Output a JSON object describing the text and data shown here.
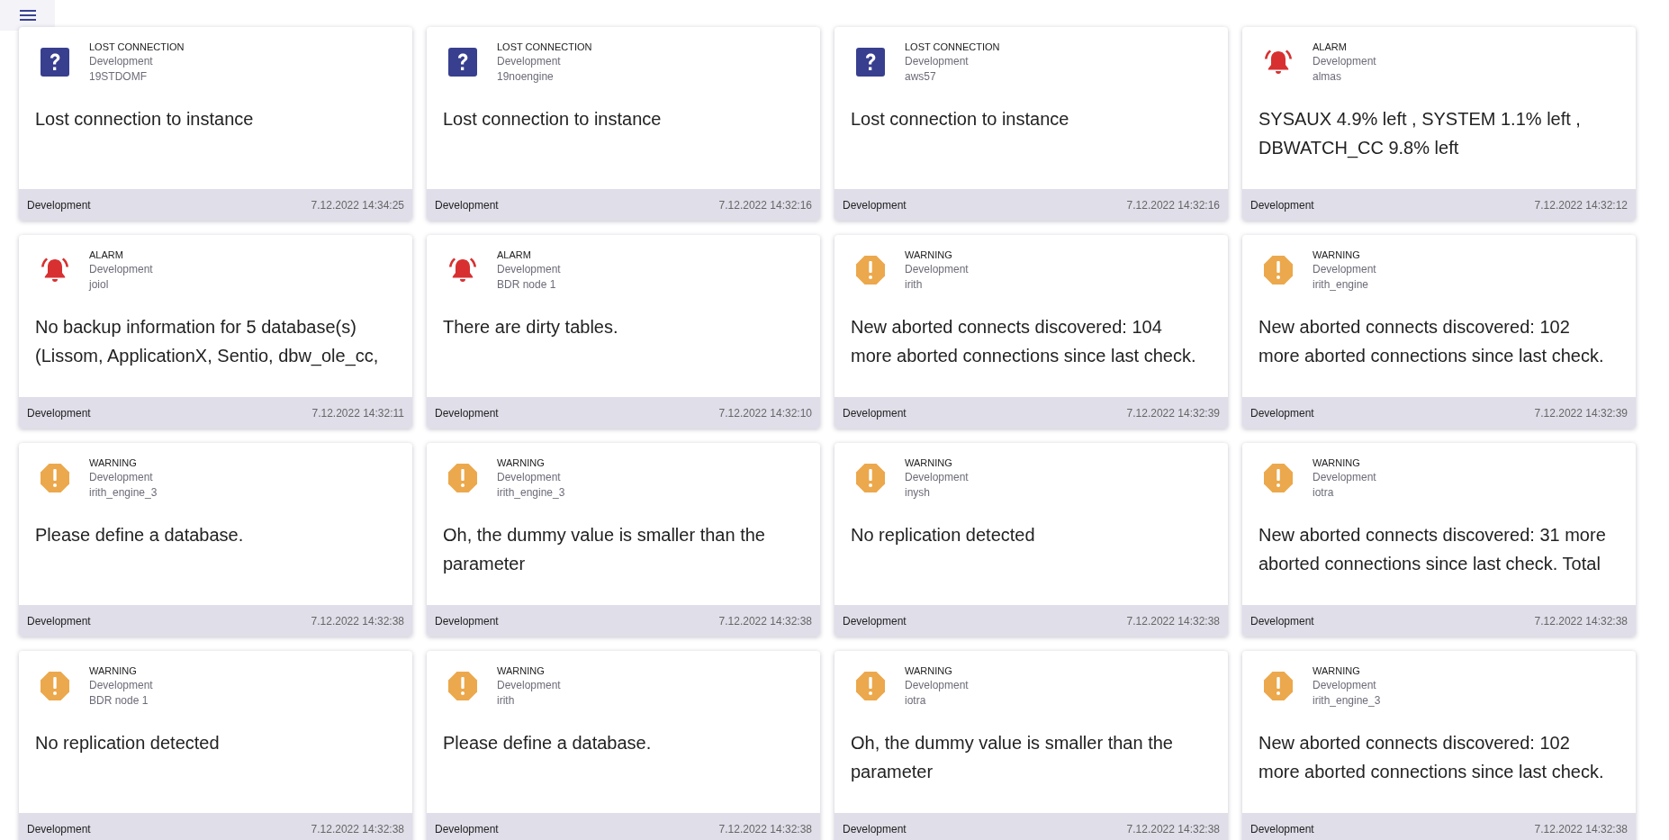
{
  "alerts": [
    {
      "kind": "lost_connection",
      "type_label": "LOST CONNECTION",
      "group": "Development",
      "instance": "19STDOMF",
      "message": "Lost connection to instance",
      "footer_group": "Development",
      "time": "7.12.2022 14:34:25"
    },
    {
      "kind": "lost_connection",
      "type_label": "LOST CONNECTION",
      "group": "Development",
      "instance": "19noengine",
      "message": "Lost connection to instance",
      "footer_group": "Development",
      "time": "7.12.2022 14:32:16"
    },
    {
      "kind": "lost_connection",
      "type_label": "LOST CONNECTION",
      "group": "Development",
      "instance": "aws57",
      "message": "Lost connection to instance",
      "footer_group": "Development",
      "time": "7.12.2022 14:32:16"
    },
    {
      "kind": "alarm",
      "type_label": "ALARM",
      "group": "Development",
      "instance": "almas",
      "message": "SYSAUX 4.9% left , SYSTEM 1.1% left , DBWATCH_CC 9.8% left",
      "footer_group": "Development",
      "time": "7.12.2022 14:32:12"
    },
    {
      "kind": "alarm",
      "type_label": "ALARM",
      "group": "Development",
      "instance": "joiol",
      "message": "No backup information for 5 database(s) (Lissom, ApplicationX, Sentio, dbw_ole_cc,",
      "footer_group": "Development",
      "time": "7.12.2022 14:32:11"
    },
    {
      "kind": "alarm",
      "type_label": "ALARM",
      "group": "Development",
      "instance": "BDR node 1",
      "message": "There are dirty tables.",
      "footer_group": "Development",
      "time": "7.12.2022 14:32:10"
    },
    {
      "kind": "warning",
      "type_label": "WARNING",
      "group": "Development",
      "instance": "irith",
      "message": "New aborted connects discovered: 104 more aborted connections since last check.",
      "footer_group": "Development",
      "time": "7.12.2022 14:32:39"
    },
    {
      "kind": "warning",
      "type_label": "WARNING",
      "group": "Development",
      "instance": "irith_engine",
      "message": "New aborted connects discovered: 102 more aborted connections since last check.",
      "footer_group": "Development",
      "time": "7.12.2022 14:32:39"
    },
    {
      "kind": "warning",
      "type_label": "WARNING",
      "group": "Development",
      "instance": "irith_engine_3",
      "message": "Please define a database.",
      "footer_group": "Development",
      "time": "7.12.2022 14:32:38"
    },
    {
      "kind": "warning",
      "type_label": "WARNING",
      "group": "Development",
      "instance": "irith_engine_3",
      "message": "Oh, the dummy value is smaller than the parameter",
      "footer_group": "Development",
      "time": "7.12.2022 14:32:38"
    },
    {
      "kind": "warning",
      "type_label": "WARNING",
      "group": "Development",
      "instance": "inysh",
      "message": "No replication detected",
      "footer_group": "Development",
      "time": "7.12.2022 14:32:38"
    },
    {
      "kind": "warning",
      "type_label": "WARNING",
      "group": "Development",
      "instance": "iotra",
      "message": "New aborted connects discovered: 31 more aborted connections since last check. Total",
      "footer_group": "Development",
      "time": "7.12.2022 14:32:38"
    },
    {
      "kind": "warning",
      "type_label": "WARNING",
      "group": "Development",
      "instance": "BDR node 1",
      "message": "No replication detected",
      "footer_group": "Development",
      "time": "7.12.2022 14:32:38"
    },
    {
      "kind": "warning",
      "type_label": "WARNING",
      "group": "Development",
      "instance": "irith",
      "message": "Please define a database.",
      "footer_group": "Development",
      "time": "7.12.2022 14:32:38"
    },
    {
      "kind": "warning",
      "type_label": "WARNING",
      "group": "Development",
      "instance": "iotra",
      "message": "Oh, the dummy value is smaller than the parameter",
      "footer_group": "Development",
      "time": "7.12.2022 14:32:38"
    },
    {
      "kind": "warning",
      "type_label": "WARNING",
      "group": "Development",
      "instance": "irith_engine_3",
      "message": "New aborted connects discovered: 102 more aborted connections since last check.",
      "footer_group": "Development",
      "time": "7.12.2022 14:32:38"
    }
  ]
}
